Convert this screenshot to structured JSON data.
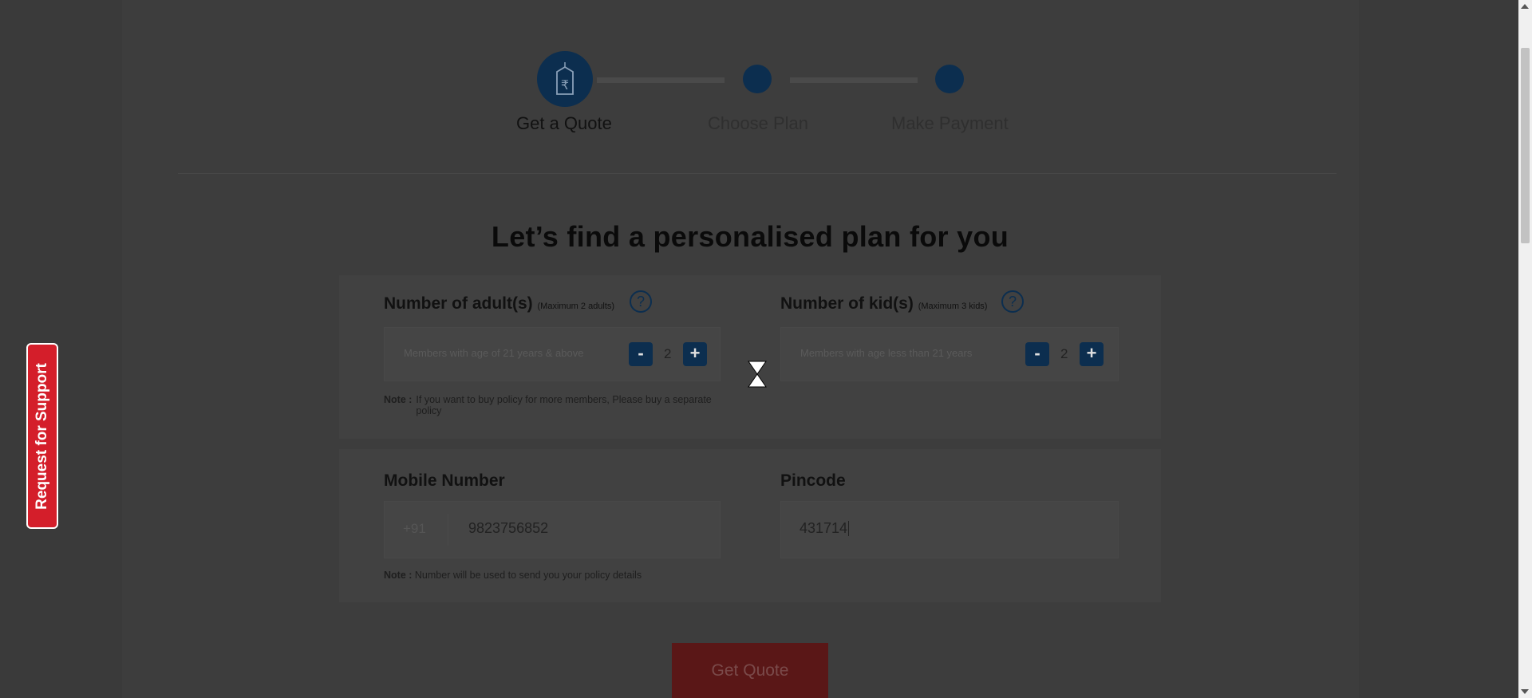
{
  "stepper": {
    "steps": [
      {
        "label": "Get a Quote",
        "icon": "price-tag-rupee-icon",
        "active": true
      },
      {
        "label": "Choose Plan",
        "active": false
      },
      {
        "label": "Make Payment",
        "active": false
      }
    ]
  },
  "main": {
    "heading": "Let’s find a personalised plan for you"
  },
  "adults": {
    "title": "Number of adult(s)",
    "subtitle": "(Maximum 2 adults)",
    "placeholder": "Members with age of 21 years & above",
    "minus": "-",
    "count": "2",
    "plus": "+"
  },
  "kids": {
    "title": "Number of kid(s)",
    "subtitle": "(Maximum 3 kids)",
    "placeholder": "Members with age less than 21 years",
    "minus": "-",
    "count": "2",
    "plus": "+"
  },
  "members_note": {
    "label": "Note :",
    "text": "If you want to buy policy for more members, Please buy a separate policy"
  },
  "mobile": {
    "title": "Mobile Number",
    "prefix": "+91",
    "value": "9823756852"
  },
  "pincode": {
    "title": "Pincode",
    "value": "431714"
  },
  "mobile_note": {
    "label": "Note :",
    "text": "Number will be used to send you your policy details"
  },
  "cta": {
    "label": "Get Quote"
  },
  "support": {
    "label": "Request for Support"
  },
  "help_glyph": "?",
  "colors": {
    "overlay_background": "#3a3a3a",
    "primary_navy": "#0c2e4f",
    "cta_red": "#5a1717",
    "support_red": "#d41e2a"
  }
}
